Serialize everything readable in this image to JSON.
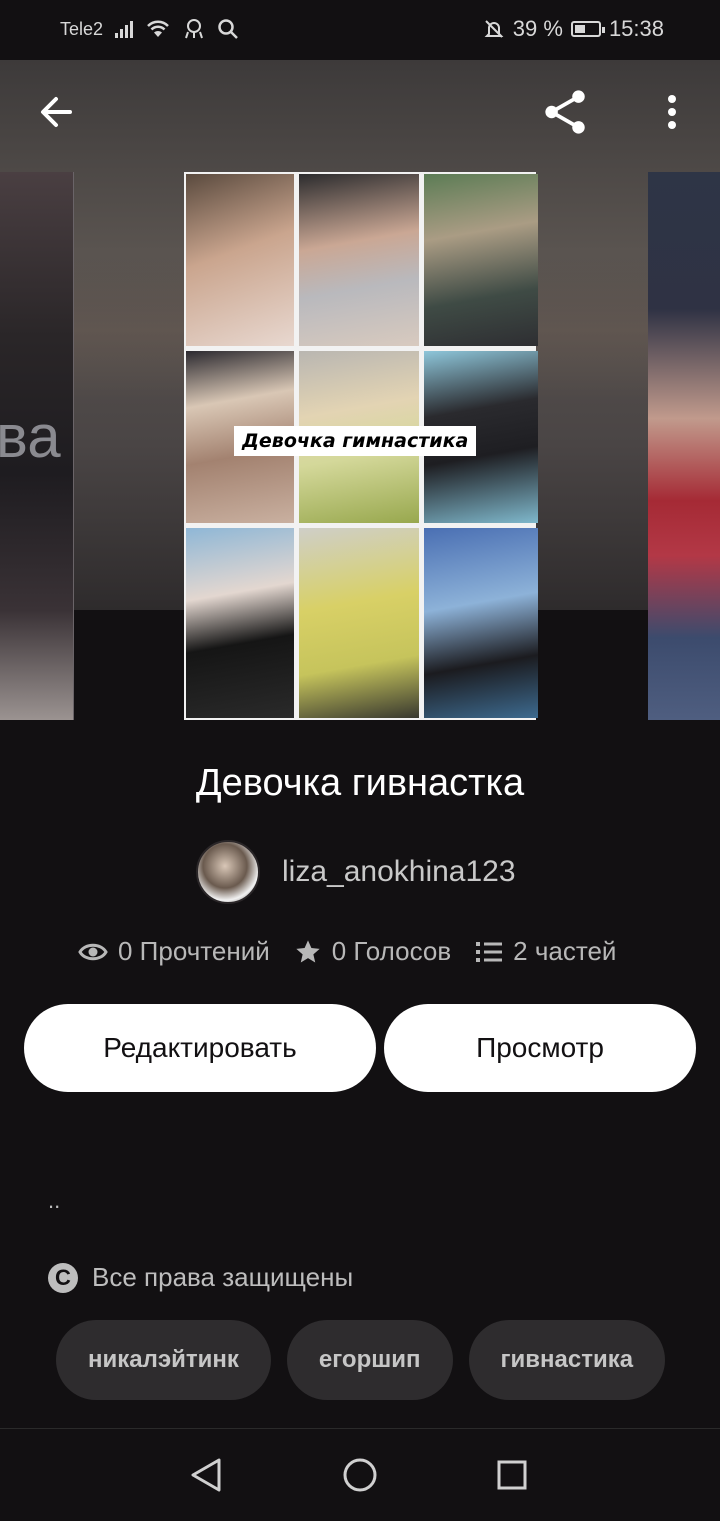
{
  "status_bar": {
    "carrier": "Tele2",
    "battery": "39 %",
    "time": "15:38"
  },
  "toolbar": {
    "back_icon": "arrow-left-icon",
    "share_icon": "share-icon",
    "more_icon": "more-vertical-icon"
  },
  "cover": {
    "title_text": "Девочка гимнастика",
    "side_left_text": "ва"
  },
  "story": {
    "title": "Девочка гивнастка",
    "author": "liza_anokhina123"
  },
  "stats": {
    "reads": "0 Прочтений",
    "votes": "0 Голосов",
    "parts": "2 частей"
  },
  "actions": {
    "edit_label": "Редактировать",
    "view_label": "Просмотр"
  },
  "description": "..",
  "rights": "Все права защищены",
  "tags": [
    "никалэйтинк",
    "егоршип",
    "гивнастика"
  ],
  "colors": {
    "background": "#121012",
    "button_bg": "#ffffff",
    "tag_bg": "#2e2c2e"
  }
}
